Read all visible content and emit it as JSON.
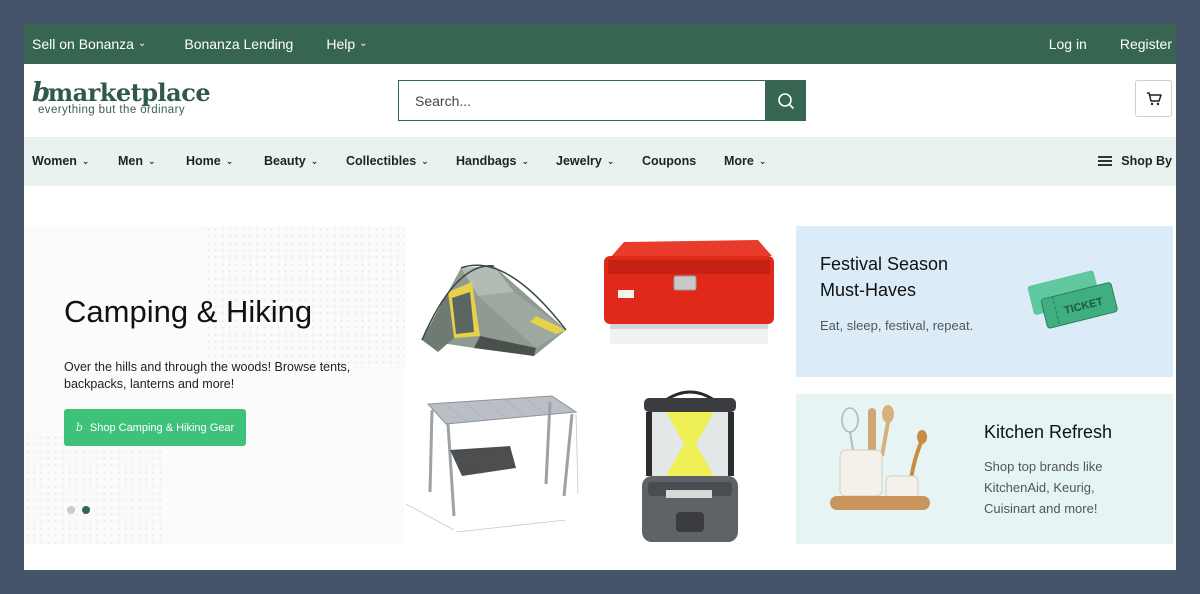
{
  "topbar": {
    "sell": "Sell on Bonanza",
    "lending": "Bonanza Lending",
    "help": "Help",
    "login": "Log in",
    "register": "Register"
  },
  "logo": {
    "b": "b",
    "word": "marketplace",
    "tagline": "everything but the ordinary"
  },
  "search": {
    "placeholder": "Search..."
  },
  "categories": [
    {
      "label": "Women"
    },
    {
      "label": "Men"
    },
    {
      "label": "Home"
    },
    {
      "label": "Beauty"
    },
    {
      "label": "Collectibles"
    },
    {
      "label": "Handbags"
    },
    {
      "label": "Jewelry"
    },
    {
      "label": "Coupons"
    },
    {
      "label": "More"
    }
  ],
  "shop_by": "Shop By",
  "hero": {
    "title": "Camping & Hiking",
    "description": "Over the hills and through the woods! Browse tents, backpacks, lanterns and more!",
    "cta": "Shop Camping & Hiking Gear",
    "cta_icon": "b",
    "carousel_active_index": 1
  },
  "products": [
    "tent",
    "cooler",
    "folding-table",
    "lantern"
  ],
  "promos": {
    "festival": {
      "title_line1": "Festival Season",
      "title_line2": "Must-Haves",
      "subtitle": "Eat, sleep, festival, repeat.",
      "ticket_text": "TICKET"
    },
    "kitchen": {
      "title": "Kitchen Refresh",
      "subtitle_line1": "Shop top brands like",
      "subtitle_line2": "KitchenAid, Keurig,",
      "subtitle_line3": "Cuisinart and more!"
    }
  },
  "colors": {
    "brand_green": "#366552",
    "cta_green": "#3ec27a",
    "nav_bg": "#e8f3f1",
    "promo_blue": "#dcebf8",
    "promo_mint": "#e6f5f3",
    "page_border": "#46546b"
  }
}
